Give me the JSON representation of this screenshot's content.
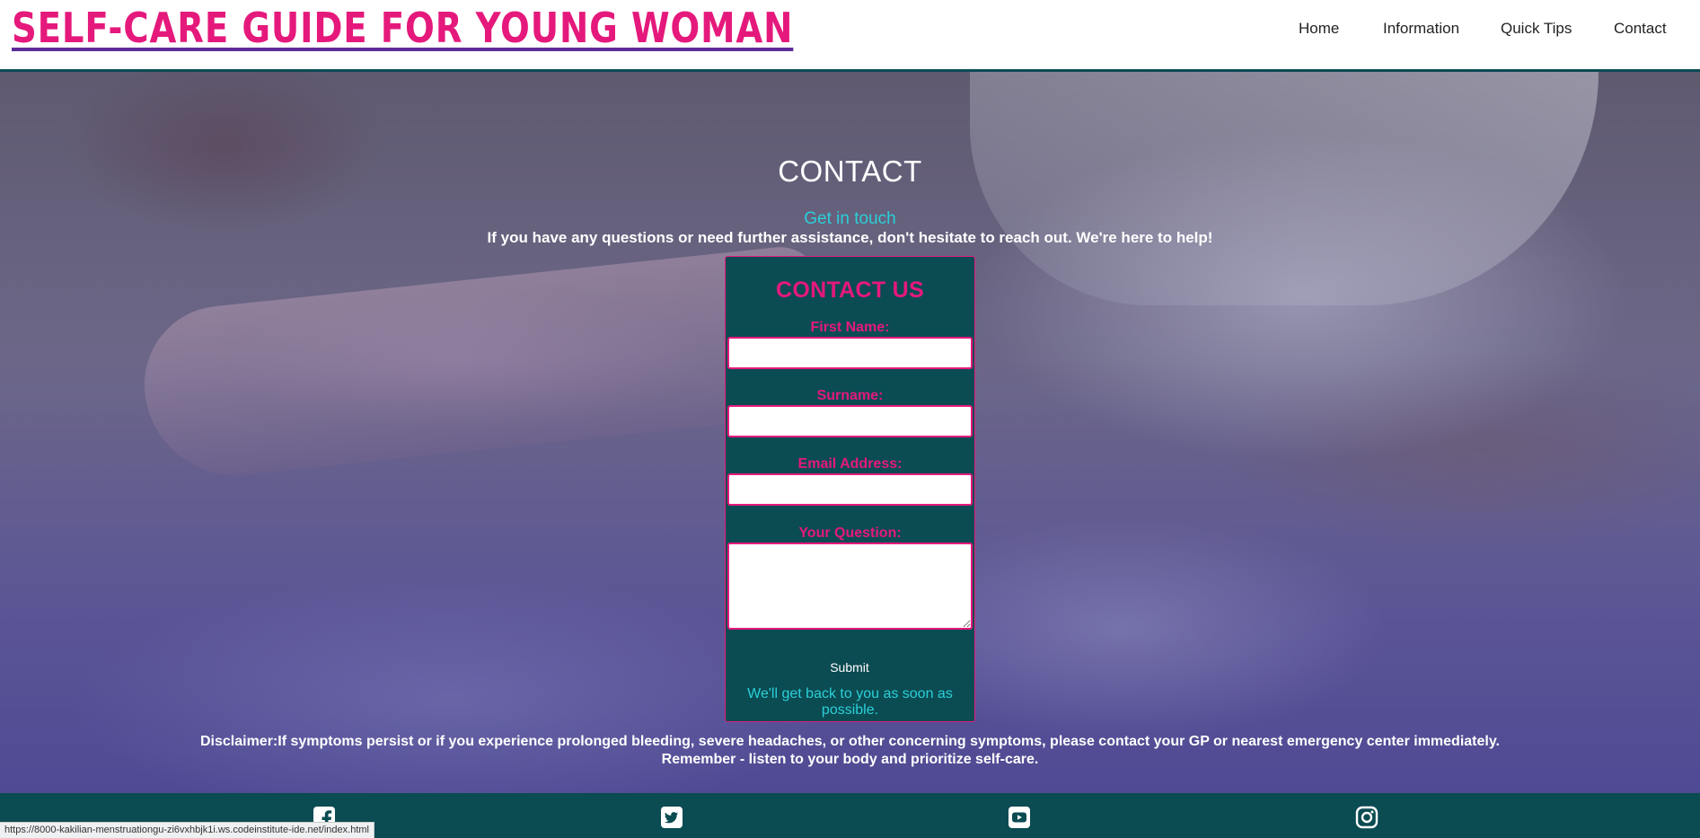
{
  "header": {
    "site_title": "SELF-CARE GUIDE FOR YOUNG WOMAN",
    "nav": [
      {
        "label": "Home"
      },
      {
        "label": "Information"
      },
      {
        "label": "Quick Tips"
      },
      {
        "label": "Contact"
      }
    ]
  },
  "contact": {
    "heading": "CONTACT",
    "subheading": "Get in touch",
    "lead": "If you have any questions or need further assistance, don't hesitate to reach out. We're here to help!"
  },
  "form": {
    "title": "CONTACT US",
    "first_name_label": "First Name:",
    "first_name_value": "",
    "surname_label": "Surname:",
    "surname_value": "",
    "email_label": "Email Address:",
    "email_value": "",
    "question_label": "Your Question:",
    "question_value": "",
    "submit_label": "Submit",
    "note": "We'll get back to you as soon as possible."
  },
  "disclaimer": {
    "line1": "Disclaimer:If symptoms persist or if you experience prolonged bleeding, severe headaches, or other concerning symptoms, please contact your GP or nearest emergency center immediately.",
    "line2": "Remember - listen to your body and prioritize self-care."
  },
  "footer": {
    "social_icons": [
      "facebook-icon",
      "twitter-icon",
      "youtube-icon",
      "instagram-icon"
    ]
  },
  "status_bar": {
    "url": "https://8000-kakilian-menstruationgu-zi6vxhbjk1i.ws.codeinstitute-ide.net/index.html"
  },
  "colors": {
    "brand_pink": "#e5197c",
    "teal_dark": "#0b4b52",
    "accent_cyan": "#2ad0d8"
  }
}
